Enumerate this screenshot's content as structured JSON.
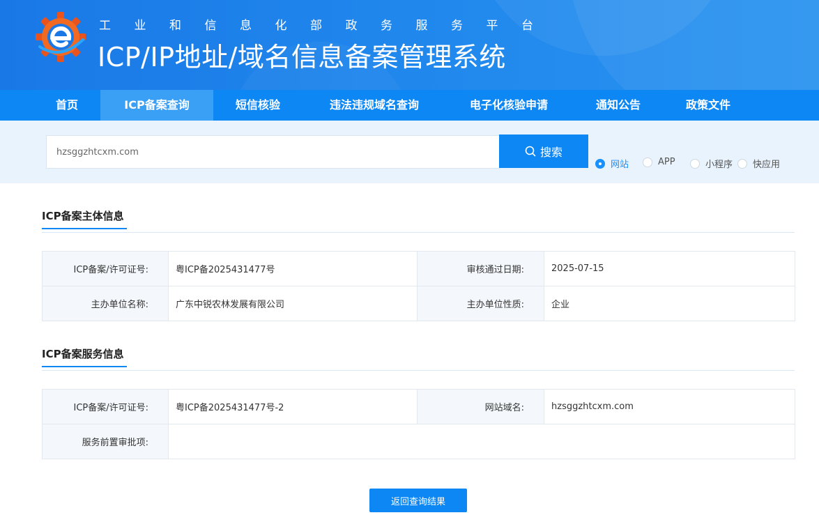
{
  "header": {
    "subtitle": "工业和信息化部政务服务平台",
    "title": "ICP/IP地址/域名信息备案管理系统"
  },
  "nav": {
    "items": [
      {
        "label": "首页"
      },
      {
        "label": "ICP备案查询",
        "active": true
      },
      {
        "label": "短信核验"
      },
      {
        "label": "违法违规域名查询"
      },
      {
        "label": "电子化核验申请"
      },
      {
        "label": "通知公告"
      },
      {
        "label": "政策文件"
      }
    ]
  },
  "search": {
    "value": "hzsggzhtcxm.com",
    "button_label": "搜索",
    "options": [
      {
        "label": "网站",
        "checked": true
      },
      {
        "label": "APP",
        "checked": false
      },
      {
        "label": "小程序",
        "checked": false
      },
      {
        "label": "快应用",
        "checked": false
      }
    ]
  },
  "subject_info": {
    "title": "ICP备案主体信息",
    "license_label": "ICP备案/许可证号:",
    "license_value": "粤ICP备2025431477号",
    "approve_date_label": "审核通过日期:",
    "approve_date_value": "2025-07-15",
    "org_name_label": "主办单位名称:",
    "org_name_value": "广东中锐农林发展有限公司",
    "org_type_label": "主办单位性质:",
    "org_type_value": "企业"
  },
  "service_info": {
    "title": "ICP备案服务信息",
    "license_label": "ICP备案/许可证号:",
    "license_value": "粤ICP备2025431477号-2",
    "domain_label": "网站域名:",
    "domain_value": "hzsggzhtcxm.com",
    "pre_approval_label": "服务前置审批项:",
    "pre_approval_value": ""
  },
  "back_button_label": "返回查询结果",
  "colors": {
    "primary": "#0d87f3",
    "nav_active": "#3aa0f5",
    "search_band": "#e8f3fe",
    "radio_checked": "#1890ff"
  }
}
